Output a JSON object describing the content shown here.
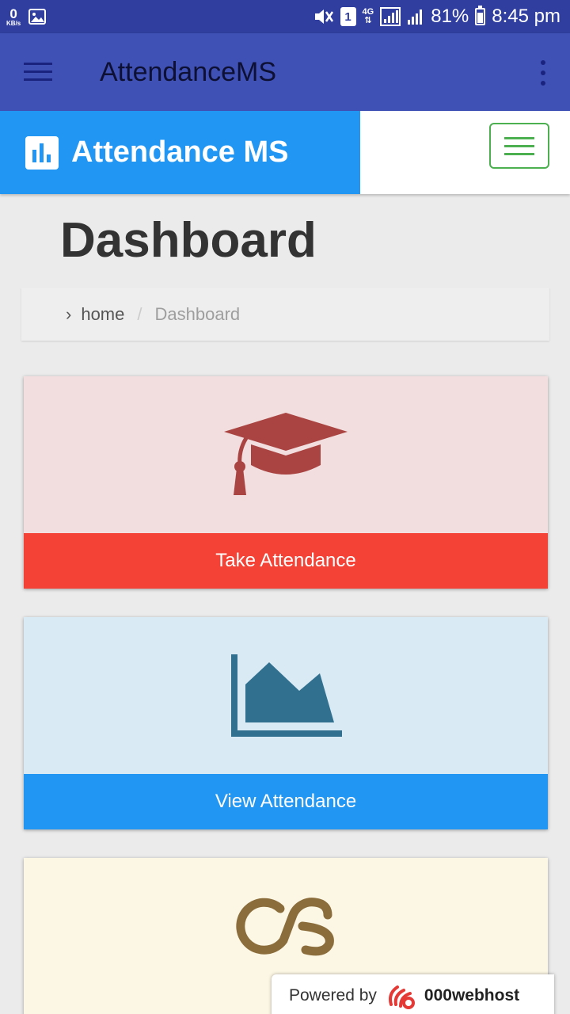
{
  "status_bar": {
    "speed_value": "0",
    "speed_unit": "KB/s",
    "sim_slot": "1",
    "network": "4G",
    "battery": "81%",
    "time": "8:45 pm"
  },
  "appbar": {
    "title": "AttendanceMS"
  },
  "site": {
    "brand": "Attendance MS"
  },
  "page": {
    "title": "Dashboard",
    "breadcrumb": {
      "home": "home",
      "separator": "/",
      "current": "Dashboard"
    }
  },
  "cards": {
    "take": {
      "label": "Take Attendance",
      "icon": "graduation-cap-icon",
      "color": "#f44336"
    },
    "view": {
      "label": "View Attendance",
      "icon": "area-chart-icon",
      "color": "#2196f3"
    },
    "third": {
      "icon": "lastfm-icon"
    }
  },
  "powered": {
    "prefix": "Powered by",
    "brand": "000webhost"
  },
  "colors": {
    "status_bar": "#303f9f",
    "appbar": "#3f51b5",
    "brand": "#2196f3",
    "toggler": "#4caf50"
  }
}
